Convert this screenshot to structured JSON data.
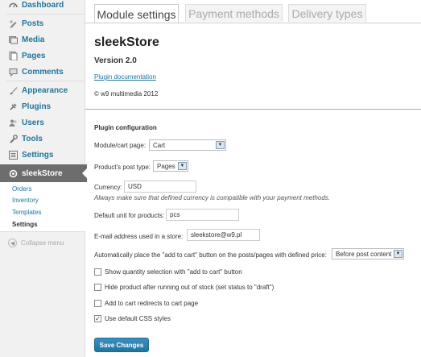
{
  "sidebar": {
    "items": [
      {
        "label": "Dashboard",
        "icon": "dashboard-icon"
      },
      {
        "label": "Posts",
        "icon": "posts-icon"
      },
      {
        "label": "Media",
        "icon": "media-icon"
      },
      {
        "label": "Pages",
        "icon": "pages-icon"
      },
      {
        "label": "Comments",
        "icon": "comments-icon"
      },
      {
        "label": "Appearance",
        "icon": "appearance-icon"
      },
      {
        "label": "Plugins",
        "icon": "plugins-icon"
      },
      {
        "label": "Users",
        "icon": "users-icon"
      },
      {
        "label": "Tools",
        "icon": "tools-icon"
      },
      {
        "label": "Settings",
        "icon": "settings-icon"
      }
    ],
    "active_menu": {
      "label": "sleekStore",
      "icon": "sleekstore-icon"
    },
    "submenu": [
      "Orders",
      "Inventory",
      "Templates",
      "Settings"
    ],
    "current_submenu": "Settings",
    "collapse_label": "Collapse menu"
  },
  "tabs": [
    {
      "label": "Module settings",
      "active": true
    },
    {
      "label": "Payment methods",
      "active": false
    },
    {
      "label": "Delivery types",
      "active": false
    }
  ],
  "plugin": {
    "name": "sleekStore",
    "version": "Version 2.0",
    "doc_link": "Plugin documentation",
    "copyright": "© w9 multimedia 2012"
  },
  "config": {
    "title": "Plugin configuration",
    "module_page": {
      "label": "Module/cart page:",
      "value": "Cart"
    },
    "post_type": {
      "label": "Product's post type:",
      "value": "Pages"
    },
    "currency": {
      "label": "Currency:",
      "value": "USD",
      "note": "Always make sure that defined currency is compatible with your payment methods."
    },
    "unit": {
      "label": "Default unit for products:",
      "value": "pcs"
    },
    "email": {
      "label": "E-mail address used in a store:",
      "value": "sleekstore@w9.pl"
    },
    "auto_place": {
      "label": "Automatically place the \"add to cart\" button on the posts/pages with defined price:",
      "value": "Before post content"
    },
    "checkboxes": [
      {
        "label": "Show quantity selection with \"add to cart\" button",
        "checked": false
      },
      {
        "label": "Hide product after running out of stock (set status to \"draft\")",
        "checked": false
      },
      {
        "label": "Add to cart redirects to cart page",
        "checked": false
      },
      {
        "label": "Use default CSS styles",
        "checked": true
      }
    ]
  },
  "save_label": "Save Changes",
  "colors": {
    "link": "#21759b",
    "active_menu_bg": "#6d6d6d",
    "button_bg": "#21759b"
  }
}
